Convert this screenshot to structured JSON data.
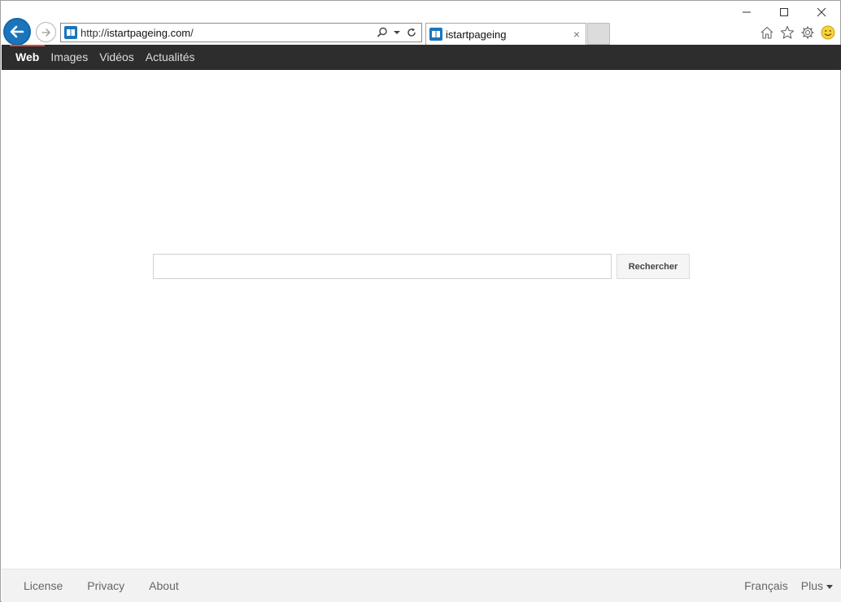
{
  "browser": {
    "url_prefix": "http://",
    "url_host": "istartpageing.com",
    "url_suffix": "/",
    "tab_title": "istartpageing",
    "tab_close": "×"
  },
  "nav": {
    "items": [
      {
        "label": "Web",
        "active": true
      },
      {
        "label": "Images",
        "active": false
      },
      {
        "label": "Vidéos",
        "active": false
      },
      {
        "label": "Actualités",
        "active": false
      }
    ]
  },
  "search": {
    "value": "",
    "button_label": "Rechercher"
  },
  "footer": {
    "links": [
      "License",
      "Privacy",
      "About"
    ],
    "language": "Français",
    "more": "Plus"
  },
  "colors": {
    "accent": "#1b75bc",
    "nav_bg": "#2d2d2d",
    "nav_active_marker": "#dd4b39"
  }
}
